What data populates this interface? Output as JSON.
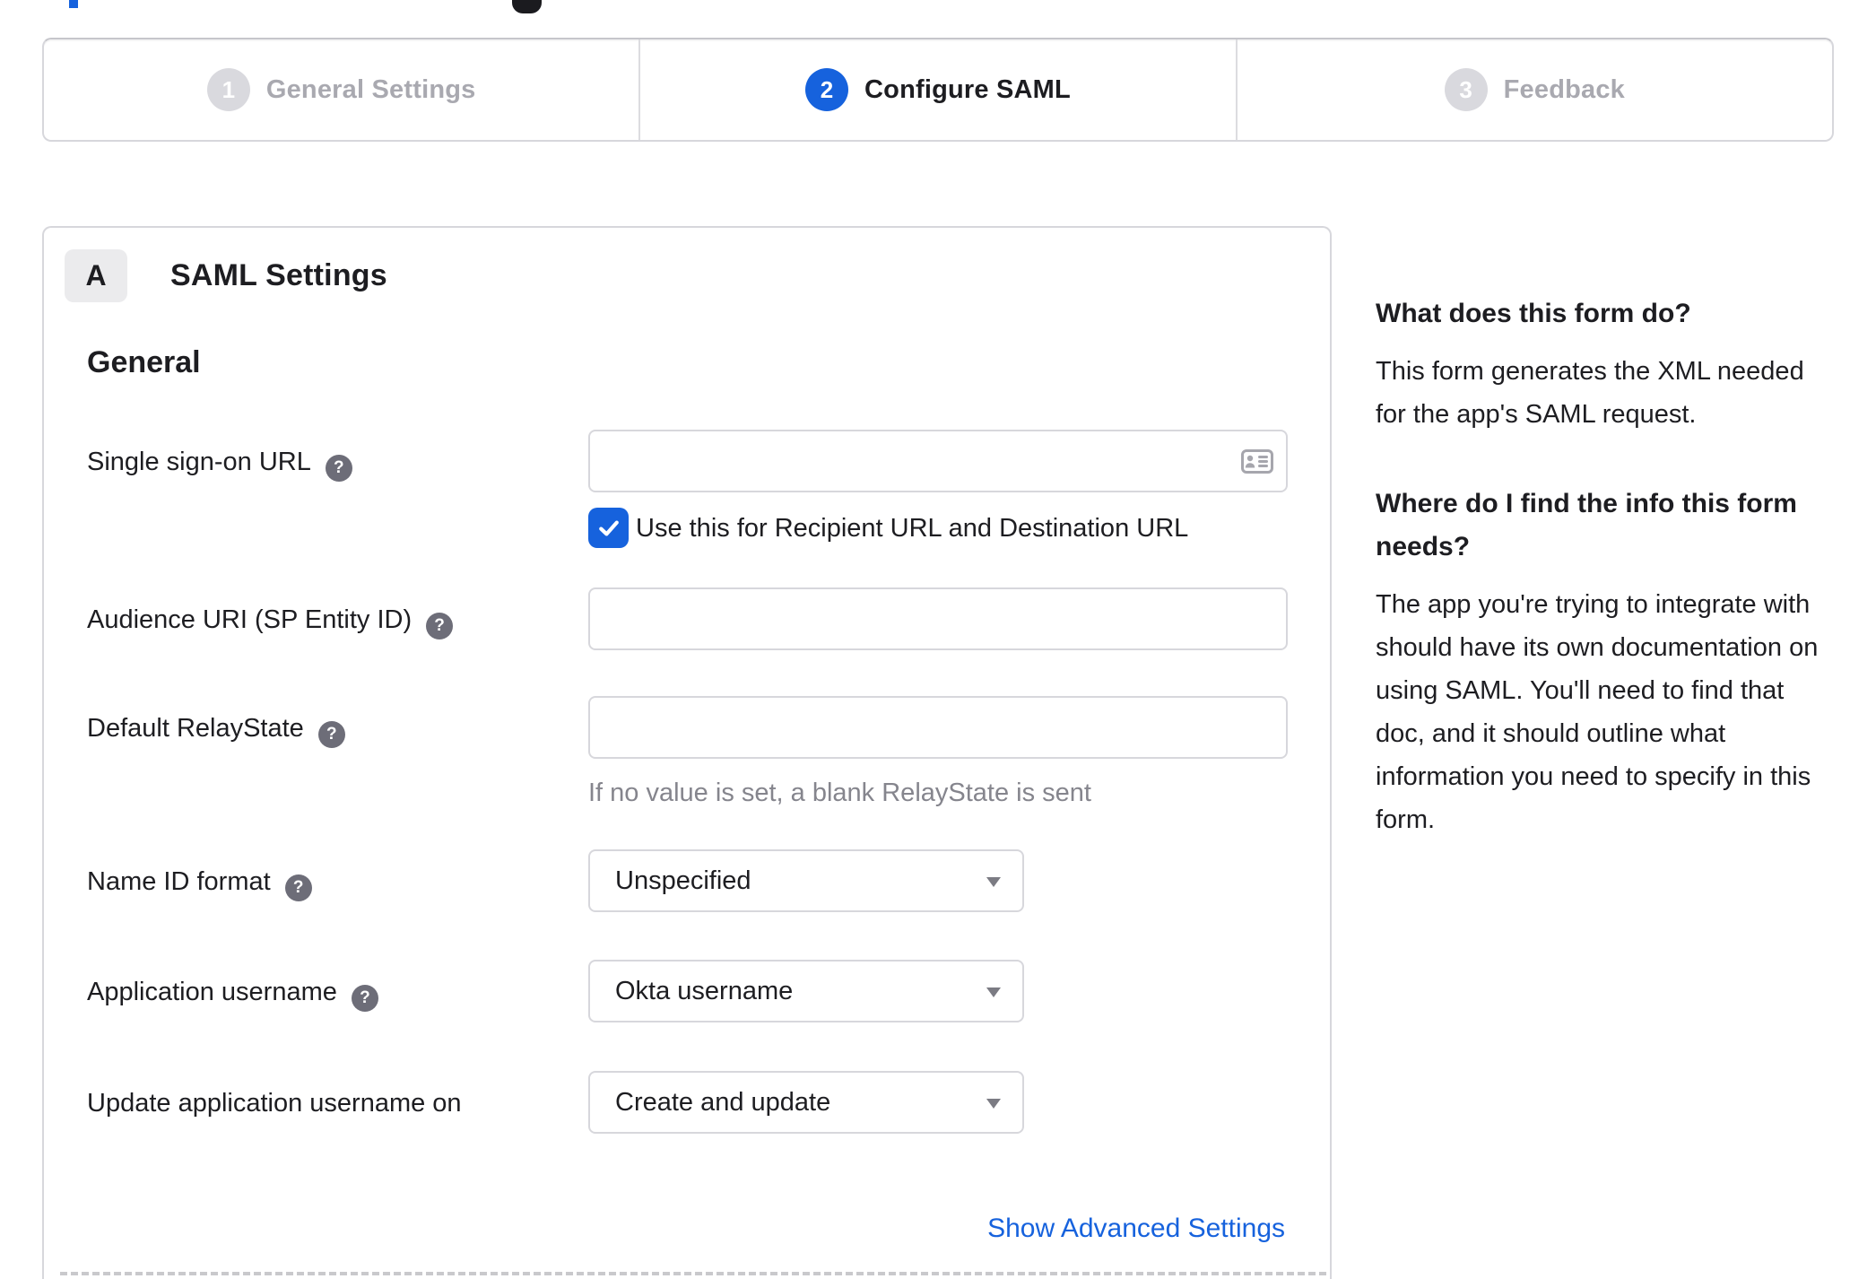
{
  "ui": {
    "help_glyph": "?",
    "colors": {
      "accent_blue": "#1662dd",
      "dark_text": "#1d1d21",
      "muted_text": "#a9a9b0",
      "helper_text": "#85858d",
      "border_gray": "#d7d7dc",
      "help_icon_bg": "#6d6d78",
      "badge_bg": "#ebebed",
      "inactive_circle": "#d9d9de",
      "icon_gray": "#a6a6ad"
    }
  },
  "stepper": {
    "steps": [
      {
        "number": "1",
        "label": "General Settings"
      },
      {
        "number": "2",
        "label": "Configure SAML"
      },
      {
        "number": "3",
        "label": "Feedback"
      }
    ]
  },
  "form_card": {
    "section_badge": "A",
    "section_title": "SAML Settings",
    "group_heading": "General",
    "fields": {
      "single_sign_on_url": {
        "label": "Single sign-on URL",
        "value": "",
        "checkbox_label": "Use this for Recipient URL and Destination URL",
        "checkbox_checked": true
      },
      "audience_uri": {
        "label": "Audience URI (SP Entity ID)",
        "value": ""
      },
      "default_relay_state": {
        "label": "Default RelayState",
        "value": "",
        "helper": "If no value is set, a blank RelayState is sent"
      },
      "name_id_format": {
        "label": "Name ID format",
        "value": "Unspecified"
      },
      "application_username": {
        "label": "Application username",
        "value": "Okta username"
      },
      "update_application_username_on": {
        "label": "Update application username on",
        "value": "Create and update"
      }
    },
    "advanced_link": "Show Advanced Settings"
  },
  "help_panel": {
    "sections": [
      {
        "heading": "What does this form do?",
        "body": "This form generates the XML needed for the app's SAML request."
      },
      {
        "heading": "Where do I find the info this form needs?",
        "body": "The app you're trying to integrate with should have its own documentation on using SAML. You'll need to find that doc, and it should outline what information you need to specify in this form."
      }
    ]
  }
}
